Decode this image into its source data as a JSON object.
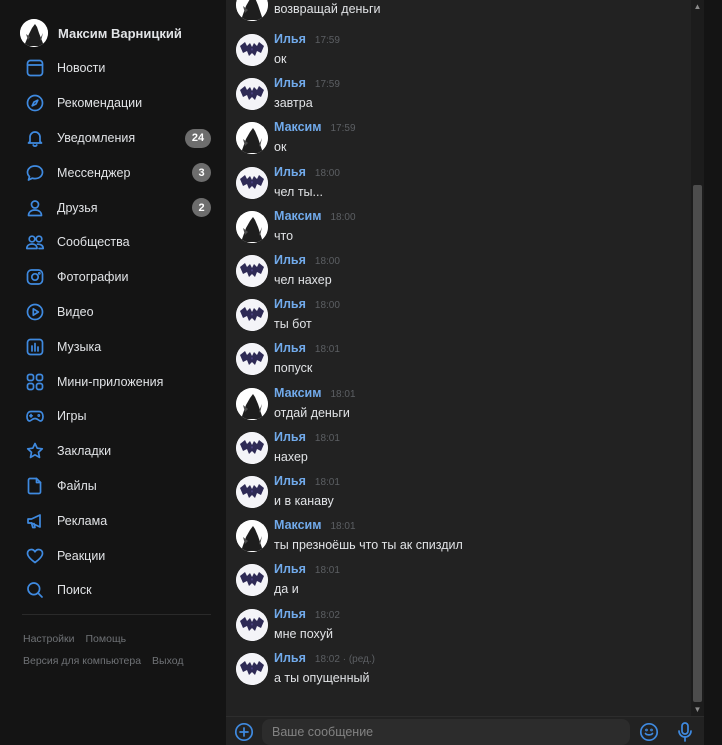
{
  "sidebar": {
    "profile_name": "Максим Варницкий",
    "items": [
      {
        "label": "Новости",
        "icon": "news-icon"
      },
      {
        "label": "Рекомендации",
        "icon": "compass-icon"
      },
      {
        "label": "Уведомления",
        "icon": "bell-icon",
        "badge": "24"
      },
      {
        "label": "Мессенджер",
        "icon": "message-icon",
        "badge": "3"
      },
      {
        "label": "Друзья",
        "icon": "user-icon",
        "badge": "2"
      },
      {
        "label": "Сообщества",
        "icon": "users-icon"
      },
      {
        "label": "Фотографии",
        "icon": "camera-icon"
      },
      {
        "label": "Видео",
        "icon": "play-icon"
      },
      {
        "label": "Музыка",
        "icon": "music-icon"
      },
      {
        "label": "Мини-приложения",
        "icon": "apps-icon"
      },
      {
        "label": "Игры",
        "icon": "gamepad-icon"
      },
      {
        "label": "Закладки",
        "icon": "star-icon"
      },
      {
        "label": "Файлы",
        "icon": "file-icon"
      },
      {
        "label": "Реклама",
        "icon": "megaphone-icon"
      },
      {
        "label": "Реакции",
        "icon": "heart-icon"
      },
      {
        "label": "Поиск",
        "icon": "search-icon"
      }
    ],
    "footer": {
      "settings": "Настройки",
      "help": "Помощь",
      "desktop": "Версия для компьютера",
      "logout": "Выход"
    }
  },
  "chat": {
    "partial_top_text": "возвращай деньги",
    "messages": [
      {
        "author": "Илья",
        "time": "17:59",
        "text": "ок",
        "avatar": "ilya"
      },
      {
        "author": "Илья",
        "time": "17:59",
        "text": "завтра",
        "avatar": "ilya"
      },
      {
        "author": "Максим",
        "time": "17:59",
        "text": "ок",
        "avatar": "max"
      },
      {
        "author": "Илья",
        "time": "18:00",
        "text": "чел ты...",
        "avatar": "ilya"
      },
      {
        "author": "Максим",
        "time": "18:00",
        "text": "что",
        "avatar": "max"
      },
      {
        "author": "Илья",
        "time": "18:00",
        "text": "чел нахер",
        "avatar": "ilya"
      },
      {
        "author": "Илья",
        "time": "18:00",
        "text": "ты бот",
        "avatar": "ilya"
      },
      {
        "author": "Илья",
        "time": "18:01",
        "text": "попуск",
        "avatar": "ilya"
      },
      {
        "author": "Максим",
        "time": "18:01",
        "text": "отдай деньги",
        "avatar": "max"
      },
      {
        "author": "Илья",
        "time": "18:01",
        "text": "нахер",
        "avatar": "ilya"
      },
      {
        "author": "Илья",
        "time": "18:01",
        "text": "и в канаву",
        "avatar": "ilya"
      },
      {
        "author": "Максим",
        "time": "18:01",
        "text": "ты презноёшь что ты ак спиздил",
        "avatar": "max"
      },
      {
        "author": "Илья",
        "time": "18:01",
        "text": "да и",
        "avatar": "ilya"
      },
      {
        "author": "Илья",
        "time": "18:02",
        "text": "мне похуй",
        "avatar": "ilya"
      },
      {
        "author": "Илья",
        "time": "18:02 · (ред.)",
        "text": "а ты опущенный",
        "avatar": "ilya"
      }
    ]
  },
  "composer": {
    "placeholder": "Ваше сообщение"
  },
  "colors": {
    "accent": "#3f8ae0",
    "author_link": "#71aaeb",
    "background": "#141414",
    "chat_background": "#222222"
  }
}
